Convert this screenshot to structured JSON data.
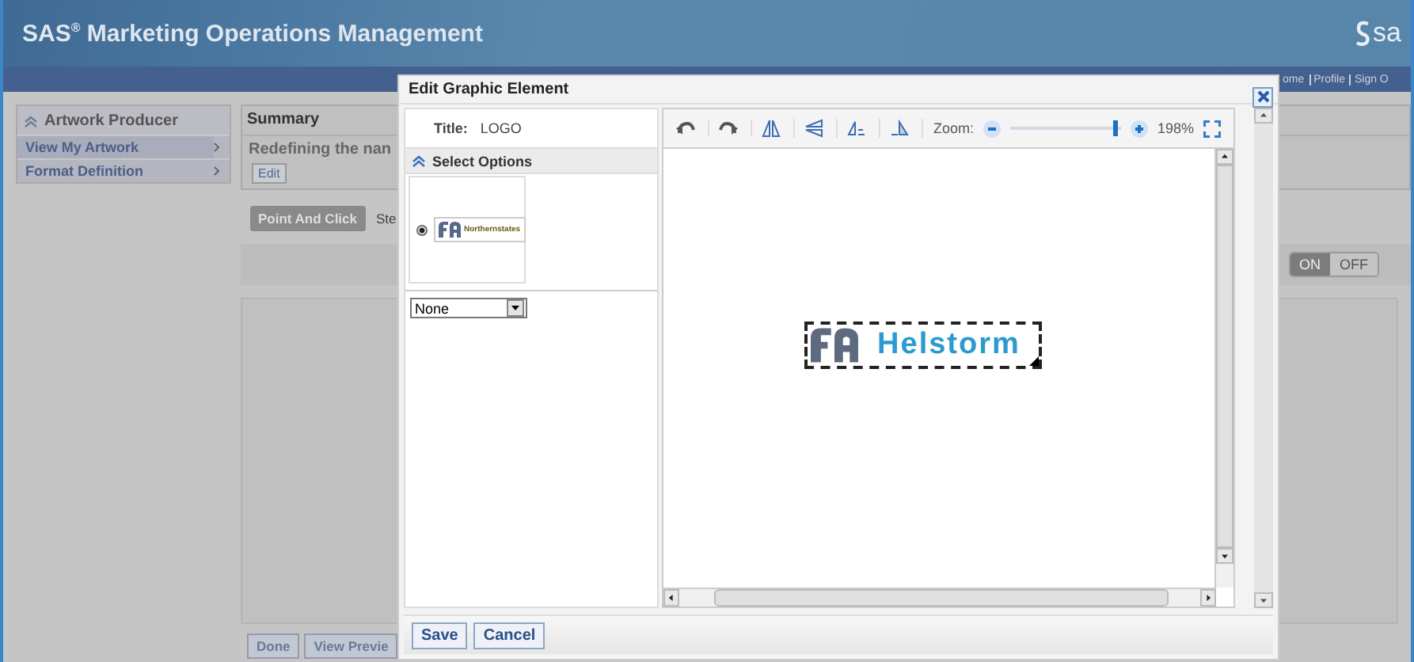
{
  "app": {
    "title": "SAS$^{®}$ Marketing Operations Management",
    "logo_text": "sa",
    "nav_links": [
      "ome",
      "Profile",
      "Sign O"
    ]
  },
  "sidebar": {
    "title": "Artwork Producer",
    "expanded": true,
    "items": [
      {
        "label": "View My Artwork",
        "selected": true
      },
      {
        "label": "Format Definition",
        "selected": false
      }
    ]
  },
  "summary": {
    "heading": "Summary",
    "text": "Redefining the nan",
    "edit_button": "Edit"
  },
  "mode_tabs": [
    {
      "label": "Point And Click",
      "selected": true
    },
    {
      "label": "Ste",
      "selected": false
    }
  ],
  "toggle": [
    {
      "label": "ON",
      "selected": true
    },
    {
      "label": "OFF",
      "selected": false
    }
  ],
  "bottom_buttons": [
    "Done",
    "View Previe"
  ],
  "dialog": {
    "title": "Edit Graphic Element",
    "title_label": "Title:",
    "title_value": "LOGO",
    "options_heading": "Select Options",
    "options_expanded": true,
    "options": [
      {
        "label": "Northernstates",
        "selected": true
      }
    ],
    "select_value": "None",
    "zoom_label": "Zoom:",
    "zoom": {
      "level": 0.93
    },
    "zoom_reading": "198%",
    "canvas_logo": "Helstorm",
    "buttons": [
      "Save",
      "Cancel"
    ]
  }
}
